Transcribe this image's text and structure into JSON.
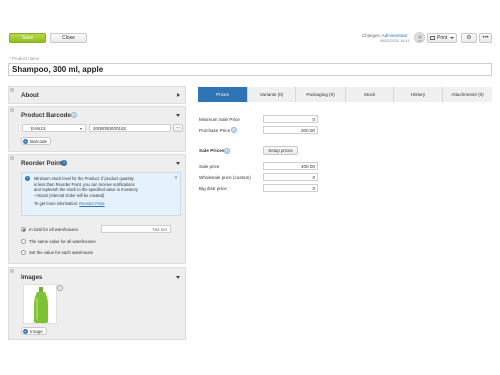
{
  "toolbar": {
    "save_label": "Save",
    "close_label": "Close",
    "changes_prefix": "Changes:",
    "changes_user": "Administrator",
    "changes_date": "06/02/2020 16:41",
    "print_label": "Print"
  },
  "product": {
    "name_label": "* Product name",
    "name_value": "Shampoo, 300 ml, apple"
  },
  "panels": {
    "about_title": "About",
    "barcodes_title": "Product Barcodes",
    "barcode_type": "EAN13",
    "barcode_value": "2000000000152",
    "barcode_add_label": "Barcode",
    "reorder_title": "Reorder Point",
    "reorder_info": [
      "Minimum stock level for the Product. If product quantity",
      "is less than Reorder Point, you can receive notifications",
      "and replenish the stock to the specified value in Inventory",
      "->Stock (Internal Order will be created)"
    ],
    "reorder_more": "To get more information:",
    "reorder_link": "Reorder Point",
    "radio_total": "In total for all warehouses",
    "not_set": "Not set",
    "radio_same": "The same value for all warehouses",
    "radio_each": "Set the value for each warehouse",
    "images_title": "Images",
    "image_add_label": "Image"
  },
  "tabs": [
    "Prices",
    "Variants (0)",
    "Packaging (0)",
    "Stock",
    "History",
    "Attachments (0)"
  ],
  "prices": {
    "min_sale_label": "Minimum Sale Price",
    "min_sale_value": "0",
    "purchase_label": "Purchase Price",
    "purchase_value": "200.00",
    "sale_prices_title": "Sale Prices",
    "setup_prices_label": "Setup prices",
    "sale_price_label": "Sale price",
    "sale_price_value": "400.00",
    "wholesale_label": "Wholesale price (custom)",
    "wholesale_value": "0",
    "bigdistr_label": "Big distr price",
    "bigdistr_value": "0"
  },
  "colors": {
    "accent": "#2f74b5",
    "save_green": "#9ccb2a",
    "info_bg": "#e6f2fb"
  }
}
